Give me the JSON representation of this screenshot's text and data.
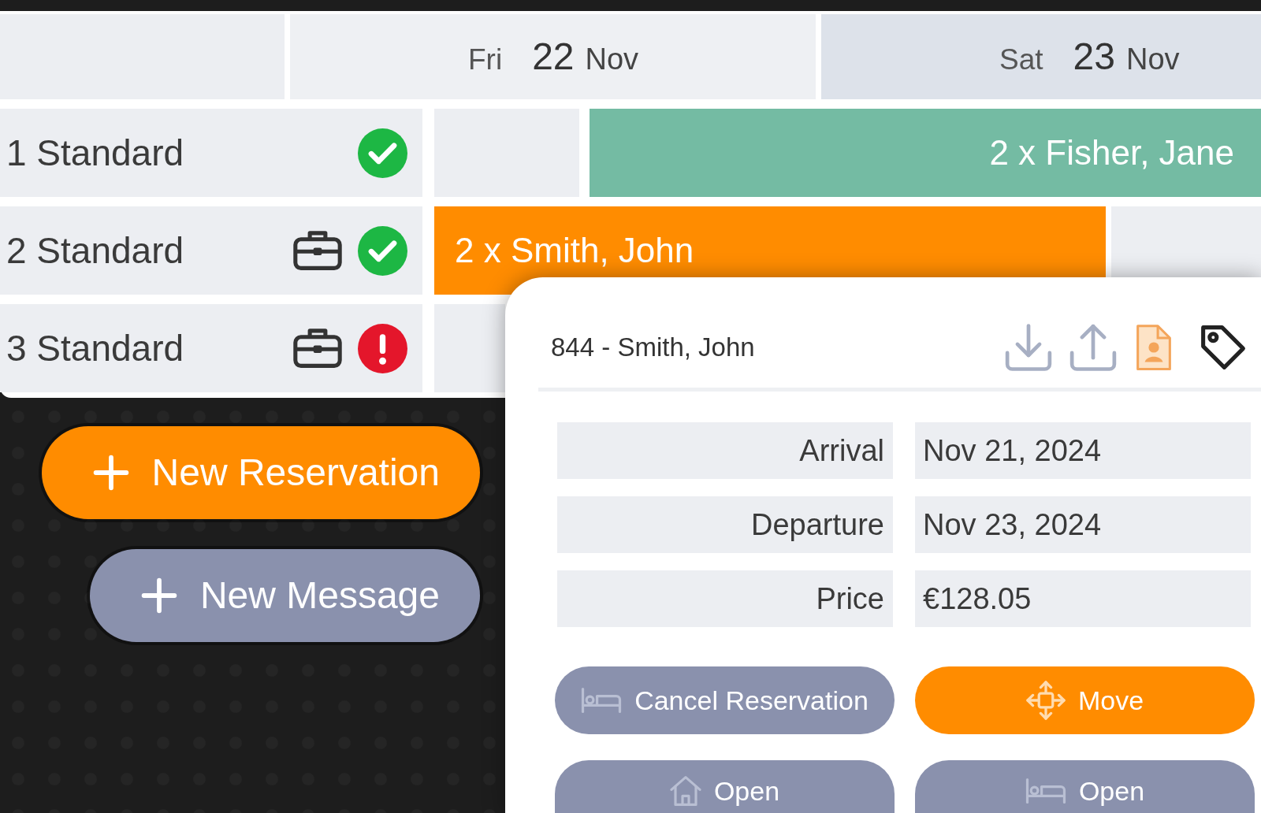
{
  "calendar": {
    "days": [
      {
        "weekday": "Fri",
        "day": "22",
        "month": "Nov",
        "weekend": false
      },
      {
        "weekday": "Sat",
        "day": "23",
        "month": "Nov",
        "weekend": true
      }
    ]
  },
  "rooms": [
    {
      "label": "1 Standard",
      "briefcase": false,
      "ready": true,
      "bookings": [
        {
          "label": "2 x Fisher, Jane",
          "color": "#74bba3",
          "kind": "arriving"
        }
      ]
    },
    {
      "label": "2 Standard",
      "briefcase": true,
      "ready": true,
      "bookings": [
        {
          "label": "2 x Smith, John",
          "color": "#ff8c00",
          "kind": "departing"
        }
      ]
    },
    {
      "label": "3 Standard",
      "briefcase": true,
      "ready": false
    }
  ],
  "actions": [
    {
      "label": "New Reservation",
      "kind": "primary"
    },
    {
      "label": "New Message",
      "kind": "secondary"
    }
  ],
  "reservation": {
    "title": "844 - Smith, John",
    "fields": [
      {
        "label": "Arrival",
        "value": "Nov 21, 2024"
      },
      {
        "label": "Departure",
        "value": "Nov 23, 2024"
      },
      {
        "label": "Price",
        "value": "€128.05"
      }
    ],
    "buttons": [
      {
        "label": "Cancel Reservation",
        "kind": "secondary"
      },
      {
        "label": "Move",
        "kind": "primary"
      },
      {
        "label": "Open",
        "kind": "secondary"
      },
      {
        "label": "Open",
        "kind": "secondary"
      }
    ]
  }
}
